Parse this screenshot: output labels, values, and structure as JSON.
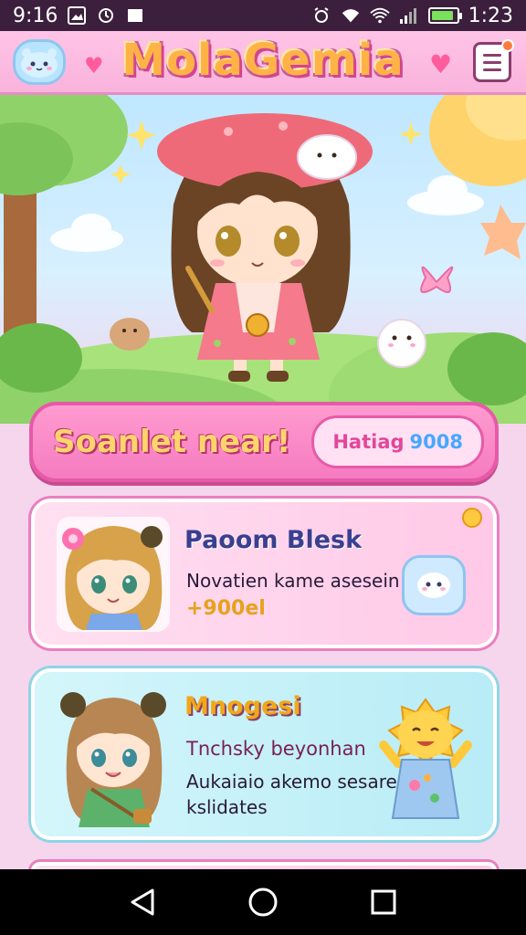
{
  "status_bar": {
    "time_left": "9:16",
    "time_right": "1:23",
    "battery_level": 0.9,
    "battery_color": "#7be05c"
  },
  "header": {
    "title": "MolaGemia",
    "left_icon": "mascot-icon",
    "right_icon": "menu-icon"
  },
  "banner": {
    "title": "Soanlet near!",
    "pill_label": "Hatiag",
    "pill_value": "9008"
  },
  "cards": [
    {
      "title": "Paoom Blesk",
      "line1": "Novatien kame asesein",
      "line2": "+900el"
    },
    {
      "title": "Mnogesi",
      "line1": "Tnchsky beyonhan",
      "line2": "Aukaiaio akemo sesare",
      "line3": "kslidates"
    }
  ],
  "colors": {
    "header_pink": "#f9b3dc",
    "banner_pink": "#f57bc0",
    "accent_orange": "#ffb347",
    "card_blue": "#b8ecf6"
  }
}
